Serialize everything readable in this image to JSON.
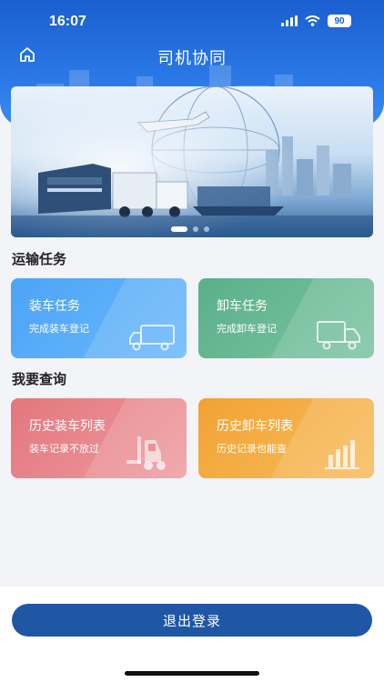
{
  "status_bar": {
    "time": "16:07",
    "battery": "90"
  },
  "nav": {
    "title": "司机协同"
  },
  "banner": {
    "slides": 3,
    "active_index": 0
  },
  "sections": {
    "transport_title": "运输任务",
    "query_title": "我要查询"
  },
  "cards": {
    "loading": {
      "title": "装车任务",
      "subtitle": "完成装车登记",
      "color": "#4aa3f5"
    },
    "unloading": {
      "title": "卸车任务",
      "subtitle": "完成卸车登记",
      "color": "#5cb38e"
    },
    "loading_history": {
      "title": "历史装车列表",
      "subtitle": "装车记录不放过",
      "color": "#e57f86"
    },
    "unloading_history": {
      "title": "历史卸车列表",
      "subtitle": "历史记录也能查",
      "color": "#f3a73b"
    }
  },
  "footer": {
    "logout_label": "退出登录"
  },
  "colors": {
    "header": "#2a78e6",
    "button": "#1f57a5",
    "page_bg": "#f3f4f8"
  },
  "icons": [
    "home-icon",
    "signal-icon",
    "wifi-icon",
    "battery-icon",
    "truck-icon",
    "forklift-icon",
    "bar-chart-icon"
  ]
}
